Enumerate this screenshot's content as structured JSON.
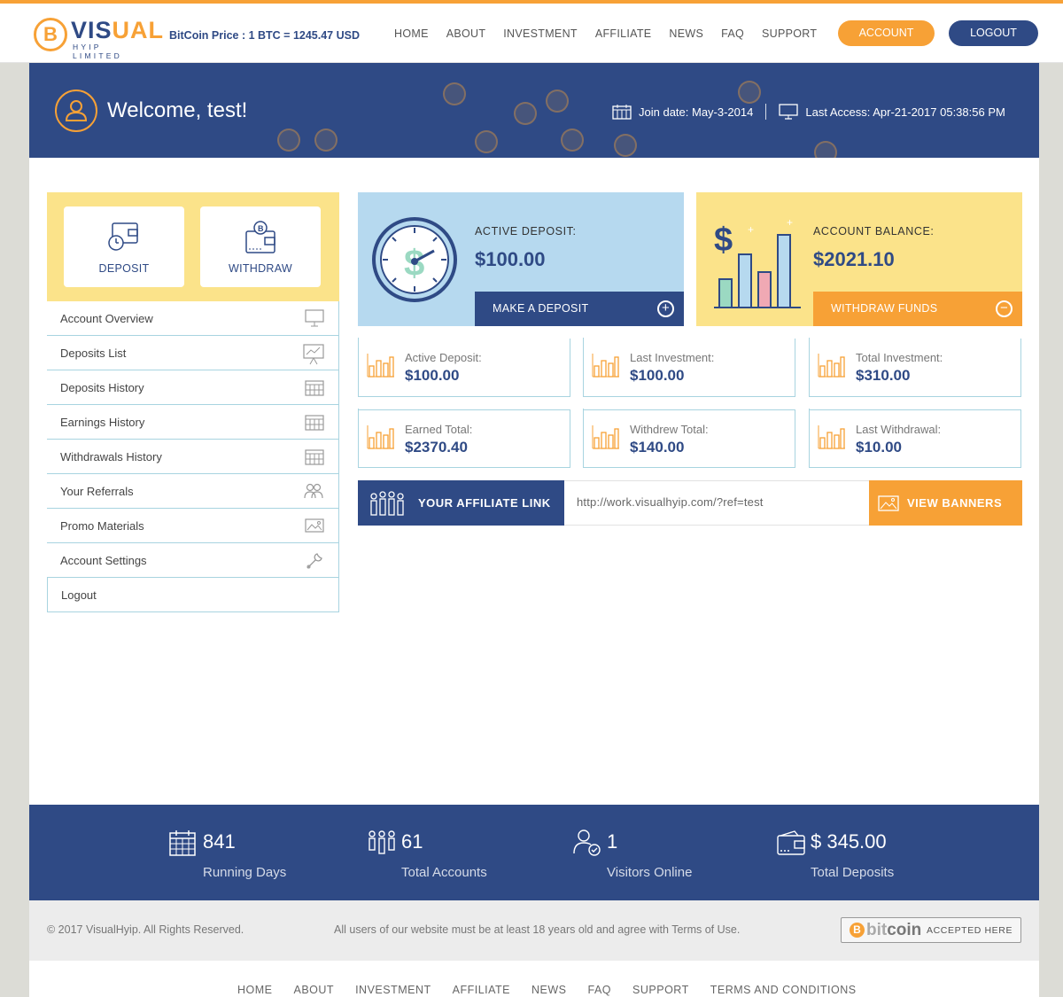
{
  "header": {
    "logo_main": "VISUAL",
    "logo_sub": "HYIP LIMITED",
    "btc_price": "BitCoin Price : 1 BTC = 1245.47 USD",
    "nav": [
      "HOME",
      "ABOUT",
      "INVESTMENT",
      "AFFILIATE",
      "NEWS",
      "FAQ",
      "SUPPORT"
    ],
    "account_label": "ACCOUNT",
    "logout_label": "LOGOUT"
  },
  "banner": {
    "welcome": "Welcome, test!",
    "join_date": "Join date: May-3-2014",
    "last_access": "Last Access: Apr-21-2017 05:38:56 PM"
  },
  "sidebar": {
    "deposit_label": "DEPOSIT",
    "withdraw_label": "WITHDRAW",
    "items": [
      {
        "label": "Account Overview",
        "icon": "monitor-icon"
      },
      {
        "label": "Deposits List",
        "icon": "presentation-icon"
      },
      {
        "label": "Deposits History",
        "icon": "calendar-icon"
      },
      {
        "label": "Earnings History",
        "icon": "calendar-icon"
      },
      {
        "label": "Withdrawals History",
        "icon": "calendar-icon"
      },
      {
        "label": "Your Referrals",
        "icon": "users-icon"
      },
      {
        "label": "Promo Materials",
        "icon": "image-icon"
      },
      {
        "label": "Account Settings",
        "icon": "wrench-icon"
      },
      {
        "label": "Logout",
        "icon": ""
      }
    ]
  },
  "active_deposit_card": {
    "label": "ACTIVE DEPOSIT:",
    "value": "$100.00",
    "button": "MAKE A DEPOSIT"
  },
  "balance_card": {
    "label": "ACCOUNT BALANCE:",
    "value": "$2021.10",
    "button": "WITHDRAW FUNDS"
  },
  "tiles": [
    {
      "label": "Active Deposit:",
      "value": "$100.00"
    },
    {
      "label": "Last Investment:",
      "value": "$100.00"
    },
    {
      "label": "Total Investment:",
      "value": "$310.00"
    },
    {
      "label": "Earned Total:",
      "value": "$2370.40"
    },
    {
      "label": "Withdrew Total:",
      "value": "$140.00"
    },
    {
      "label": "Last Withdrawal:",
      "value": "$10.00"
    }
  ],
  "affiliate": {
    "label": "YOUR AFFILIATE LINK",
    "url": "http://work.visualhyip.com/?ref=test",
    "banners_button": "VIEW BANNERS"
  },
  "stats": [
    {
      "number": "841",
      "label": "Running Days",
      "icon": "calendar-icon"
    },
    {
      "number": "61",
      "label": "Total Accounts",
      "icon": "users-icon"
    },
    {
      "number": "1",
      "label": "Visitors Online",
      "icon": "user-check-icon"
    },
    {
      "number": "$ 345.00",
      "label": "Total Deposits",
      "icon": "wallet-icon"
    }
  ],
  "footer": {
    "copyright": "© 2017 VisualHyip. All Rights Reserved.",
    "legal": "All users of our website must be at least 18 years old and agree with Terms of Use.",
    "badge_word_1": "bit",
    "badge_word_2": "coin",
    "badge_accepted": "ACCEPTED HERE",
    "nav": [
      "HOME",
      "ABOUT",
      "INVESTMENT",
      "AFFILIATE",
      "NEWS",
      "FAQ",
      "SUPPORT",
      "TERMS AND CONDITIONS"
    ]
  },
  "colors": {
    "navy": "#2f4a85",
    "orange": "#f7a136",
    "yellow": "#fbe38a",
    "light_blue": "#b6d9ef"
  }
}
